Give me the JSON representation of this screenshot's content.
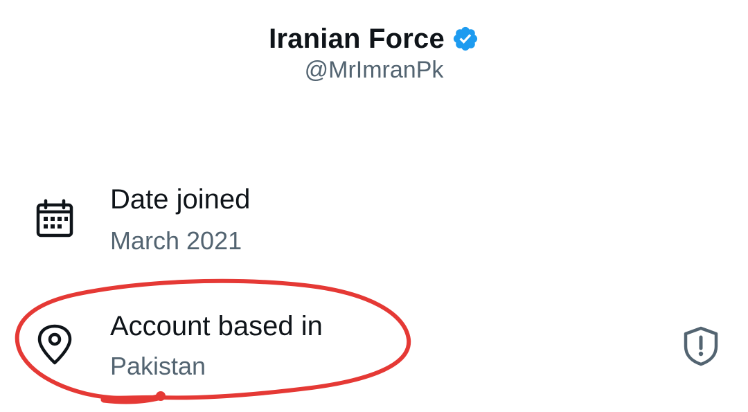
{
  "profile": {
    "display_name": "Iranian Force",
    "handle": "@MrImranPk",
    "verified": true,
    "verified_color": "#1d9bf0"
  },
  "about": {
    "date_joined": {
      "icon": "calendar-icon",
      "title": "Date joined",
      "value": "March 2021"
    },
    "account_based_in": {
      "icon": "location-pin-icon",
      "title": "Account based in",
      "value": "Pakistan",
      "action_icon": "shield-alert-icon"
    }
  },
  "colors": {
    "primary_text": "#0f1419",
    "secondary_text": "#536471",
    "annotation": "#e53935"
  }
}
